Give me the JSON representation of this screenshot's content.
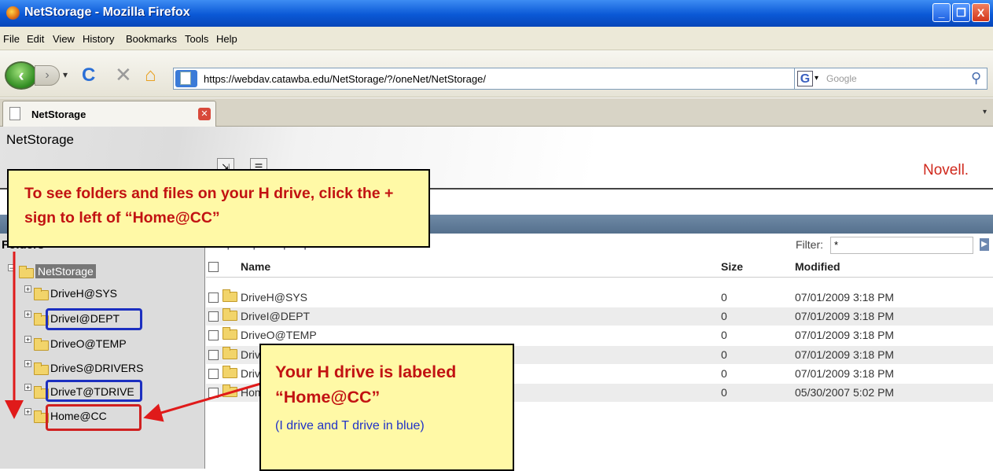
{
  "window": {
    "title": "NetStorage - Mozilla Firefox",
    "controls": [
      "_",
      "❐",
      "X"
    ]
  },
  "menu": [
    "File",
    "Edit",
    "View",
    "History",
    "Bookmarks",
    "Tools",
    "Help"
  ],
  "nav": {
    "url": "https://webdav.catawba.edu/NetStorage/?/oneNet/NetStorage/",
    "search_placeholder": "Google"
  },
  "tab": {
    "label": "NetStorage"
  },
  "header": {
    "title": "NetStorage",
    "logo": "Novell."
  },
  "tree": {
    "heading": "Folders",
    "root": "NetStorage",
    "items": [
      "DriveH@SYS",
      "DriveI@DEPT",
      "DriveO@TEMP",
      "DriveS@DRIVERS",
      "DriveT@TDRIVE",
      "Home@CC"
    ]
  },
  "list": {
    "links": "File | Edit | View | Help",
    "filter_label": "Filter:",
    "filter_value": "*",
    "columns": {
      "name": "Name",
      "size": "Size",
      "modified": "Modified"
    },
    "rows": [
      {
        "name": "DriveH@SYS",
        "size": "0",
        "modified": "07/01/2009 3:18 PM"
      },
      {
        "name": "DriveI@DEPT",
        "size": "0",
        "modified": "07/01/2009 3:18 PM"
      },
      {
        "name": "DriveO@TEMP",
        "size": "0",
        "modified": "07/01/2009 3:18 PM"
      },
      {
        "name": "DriveS@DRIVERS",
        "size": "0",
        "modified": "07/01/2009 3:18 PM"
      },
      {
        "name": "DriveT@TDRIVE",
        "size": "0",
        "modified": "07/01/2009 3:18 PM"
      },
      {
        "name": "Home@CC",
        "size": "0",
        "modified": "05/30/2007 5:02 PM"
      }
    ]
  },
  "callouts": {
    "first": "To see folders and files on your H drive, click the + sign to left of “Home@CC”",
    "second_title": "Your H drive is labeled “Home@CC”",
    "second_sub": "(I drive and T drive in blue)"
  },
  "colors": {
    "callout_fill": "#fff9a6",
    "callout_text": "#c21212",
    "highlight_blue": "#1c2fc0",
    "highlight_red": "#d02020",
    "logo_red": "#d0281c"
  }
}
